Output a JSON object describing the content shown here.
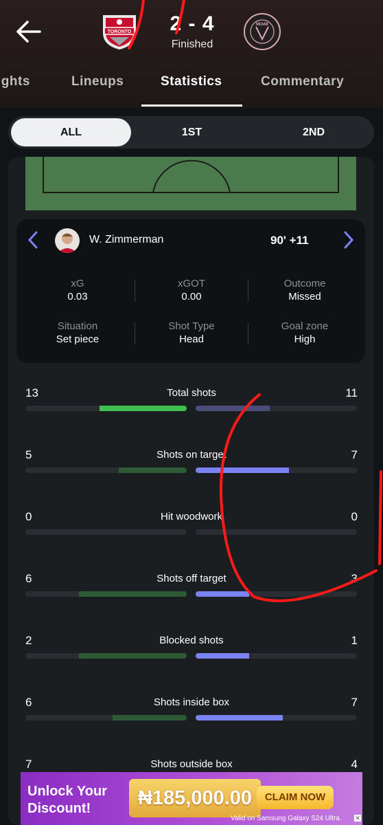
{
  "match": {
    "score": "2 - 4",
    "status": "Finished",
    "home_crest_text": "TORONTO",
    "away_crest_text": "MIAMI"
  },
  "tabs": [
    {
      "label": "ights",
      "active": false
    },
    {
      "label": "Lineups",
      "active": false
    },
    {
      "label": "Statistics",
      "active": true
    },
    {
      "label": "Commentary",
      "active": false
    }
  ],
  "periods": [
    {
      "label": "ALL",
      "active": true
    },
    {
      "label": "1ST",
      "active": false
    },
    {
      "label": "2ND",
      "active": false
    }
  ],
  "shot": {
    "player": "W. Zimmerman",
    "minute": "90' +11",
    "info": [
      {
        "label": "xG",
        "value": "0.03"
      },
      {
        "label": "xGOT",
        "value": "0.00"
      },
      {
        "label": "Outcome",
        "value": "Missed"
      },
      {
        "label": "Situation",
        "value": "Set piece"
      },
      {
        "label": "Shot Type",
        "value": "Head"
      },
      {
        "label": "Goal zone",
        "value": "High"
      }
    ]
  },
  "stats": [
    {
      "name": "Total shots",
      "home": "13",
      "away": "11",
      "home_frac": 0.54,
      "away_frac": 0.46,
      "home_color": "#3fbf4f",
      "away_color": "#4b4e7a"
    },
    {
      "name": "Shots on target",
      "home": "5",
      "away": "7",
      "home_frac": 0.42,
      "away_frac": 0.58,
      "home_color": "#2f5a36",
      "away_color": "#7b83f2"
    },
    {
      "name": "Hit woodwork",
      "home": "0",
      "away": "0",
      "home_frac": 0,
      "away_frac": 0,
      "home_color": "#2f5a36",
      "away_color": "#7b83f2"
    },
    {
      "name": "Shots off target",
      "home": "6",
      "away": "3",
      "home_frac": 0.67,
      "away_frac": 0.33,
      "home_color": "#2f5a36",
      "away_color": "#7b83f2"
    },
    {
      "name": "Blocked shots",
      "home": "2",
      "away": "1",
      "home_frac": 0.67,
      "away_frac": 0.33,
      "home_color": "#2f5a36",
      "away_color": "#7b83f2"
    },
    {
      "name": "Shots inside box",
      "home": "6",
      "away": "7",
      "home_frac": 0.46,
      "away_frac": 0.54,
      "home_color": "#2f5a36",
      "away_color": "#7b83f2"
    },
    {
      "name": "Shots outside box",
      "home": "7",
      "away": "4",
      "home_frac": 0.64,
      "away_frac": 0.36,
      "home_color": "#2f5a36",
      "away_color": "#7b83f2"
    }
  ],
  "ad": {
    "title": "Unlock Your Discount!",
    "amount": "₦185,000.00",
    "button": "CLAIM NOW",
    "fine_print": "Valid on Samsung Galaxy S24 Ultra."
  },
  "colors": {
    "accent": "#7b83f2",
    "home_bar": "#2f5a36",
    "pitch": "#4b7a4c",
    "annotation": "#ff1a1a"
  }
}
